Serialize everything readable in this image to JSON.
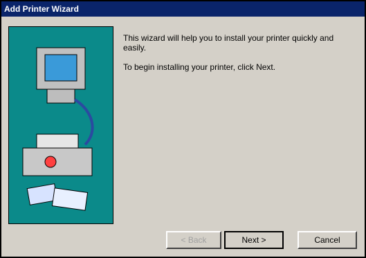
{
  "window": {
    "title": "Add Printer Wizard"
  },
  "content": {
    "paragraph1": "This wizard will help you to install your printer quickly and easily.",
    "paragraph2": "To begin installing your printer, click Next."
  },
  "buttons": {
    "back": "< Back",
    "next": "Next >",
    "cancel": "Cancel"
  },
  "icons": {
    "panel_illustration": "printer-illustration"
  }
}
